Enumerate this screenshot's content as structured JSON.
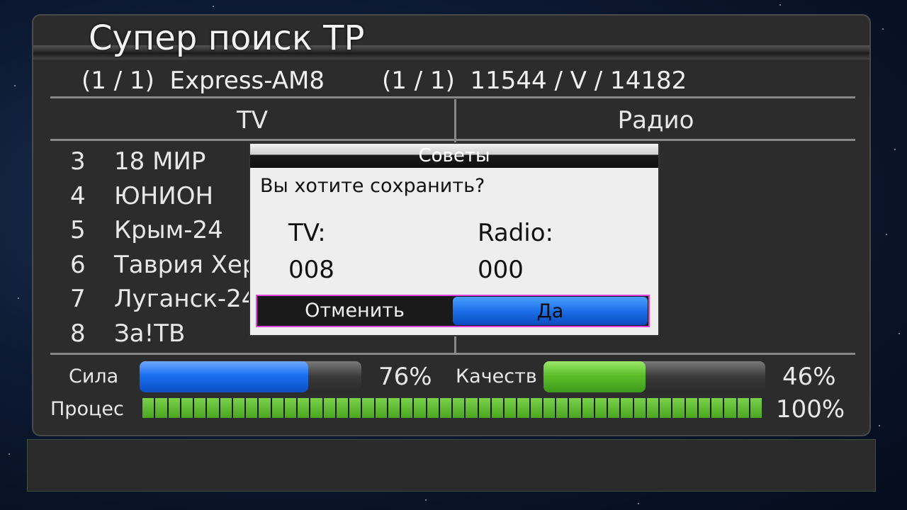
{
  "header": {
    "title": "Супер поиск TP",
    "sat_index": "(1 / 1)",
    "satellite": "Express-AM8",
    "tp_index": "(1 / 1)",
    "transponder": "11544 / V / 14182"
  },
  "columns": {
    "tv": "TV",
    "radio": "Радио"
  },
  "tv_channels": [
    {
      "num": "3",
      "name": "18 МИР"
    },
    {
      "num": "4",
      "name": "ЮНИОН"
    },
    {
      "num": "5",
      "name": "Крым-24"
    },
    {
      "num": "6",
      "name": "Таврия Херсон"
    },
    {
      "num": "7",
      "name": "Луганск-24"
    },
    {
      "num": "8",
      "name": "За!ТВ"
    }
  ],
  "signal": {
    "strength_label": "Сила",
    "strength_value": 76,
    "strength_text": "76%",
    "quality_label": "Качеств",
    "quality_value": 46,
    "quality_text": "46%",
    "progress_label": "Процес",
    "progress_value": 100,
    "progress_text": "100%"
  },
  "dialog": {
    "title": "Советы",
    "question": "Вы хотите сохранить?",
    "tv_label": "TV:",
    "tv_count": "008",
    "radio_label": "Radio:",
    "radio_count": "000",
    "cancel_label": "Отменить",
    "confirm_label": "Да",
    "selected": "confirm"
  },
  "colors": {
    "strength_bar": "#1b6ff0",
    "quality_bar": "#5cbe2a",
    "dialog_focus_border": "#e040e0"
  }
}
